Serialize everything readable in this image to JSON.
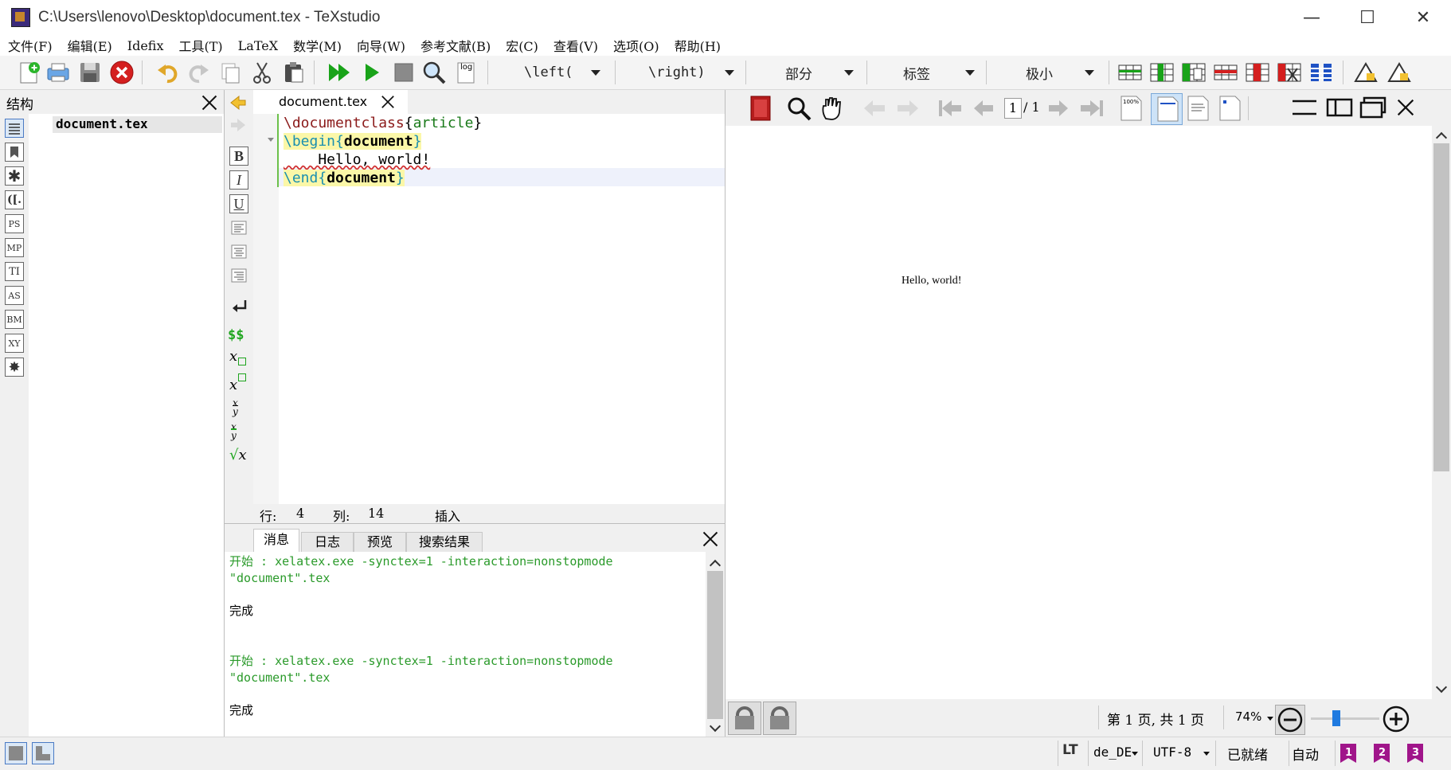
{
  "window": {
    "title": "C:\\Users\\lenovo\\Desktop\\document.tex - TeXstudio",
    "minimize": "—",
    "maximize": "☐",
    "close": "✕"
  },
  "menu": [
    "文件(F)",
    "编辑(E)",
    "Idefix",
    "工具(T)",
    "LaTeX",
    "数学(M)",
    "向导(W)",
    "参考文献(B)",
    "宏(C)",
    "查看(V)",
    "选项(O)",
    "帮助(H)"
  ],
  "toolbar": {
    "left_combo": "\\left(",
    "right_combo": "\\right)",
    "section_combo": "部分",
    "label_combo": "标签",
    "size_combo": "极小",
    "log_label": "log",
    "colors": {
      "green": "#1fa51f",
      "red": "#d41f1f",
      "blue": "#1f52c4",
      "yellow": "#f2c130"
    }
  },
  "structure": {
    "title": "结构",
    "root": "document.tex",
    "icons": [
      "list",
      "bookmark",
      "✱",
      "([.",
      "PS",
      "MP",
      "TI",
      "AS",
      "BM",
      "XY",
      "✸"
    ]
  },
  "editor": {
    "tab": "document.tex",
    "lines": [
      {
        "cmd": "\\documentclass",
        "open": "{",
        "arg": "article",
        "close": "}"
      },
      {
        "cmd": "\\begin",
        "open": "{",
        "arg": "document",
        "close": "}"
      },
      {
        "text": "    Hello, world!"
      },
      {
        "cmd": "\\end",
        "open": "{",
        "arg": "document",
        "close": "}"
      }
    ],
    "status": {
      "row_label": "行:",
      "row": "4",
      "col_label": "列:",
      "col": "14",
      "mode": "插入"
    },
    "format_buttons": [
      "B",
      "I",
      "U"
    ]
  },
  "messages": {
    "tabs": [
      "消息",
      "日志",
      "预览",
      "搜索结果"
    ],
    "entries": [
      {
        "cmd": "开始 : xelatex.exe -synctex=1 -interaction=nonstopmode",
        "file": "\"document\".tex",
        "done": "完成"
      },
      {
        "cmd": "开始 : xelatex.exe -synctex=1 -interaction=nonstopmode",
        "file": "\"document\".tex",
        "done": "完成"
      }
    ]
  },
  "pdf": {
    "page_input": "1",
    "page_total": "/ 1",
    "content": "Hello, world!",
    "status_page": "第 1 页, 共 1 页",
    "zoom": "74%"
  },
  "statusbar": {
    "lt": "LT",
    "lang": "de_DE",
    "encoding": "UTF-8",
    "state": "已就绪",
    "auto": "自动"
  }
}
